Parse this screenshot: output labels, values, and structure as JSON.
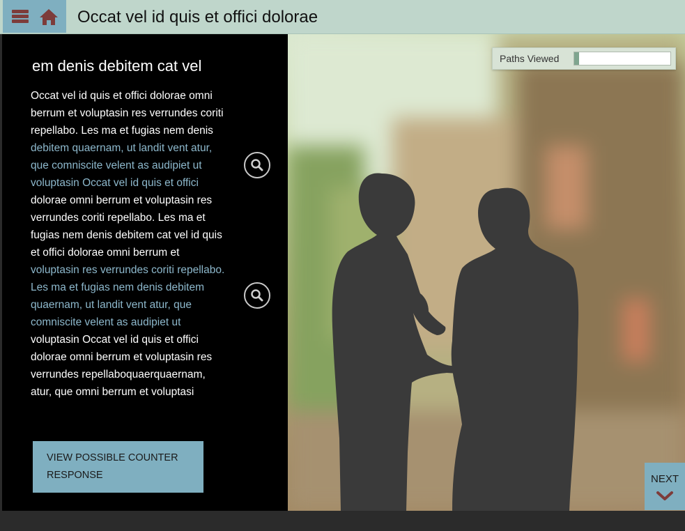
{
  "header": {
    "title": "Occat vel id quis et offici dolorae",
    "menu_icon": "hamburger-menu-icon",
    "home_icon": "home-icon"
  },
  "panel": {
    "title": "em denis debitem cat vel",
    "lines": [
      {
        "text": "Occat vel id quis et offici dolorae omni",
        "highlight": false
      },
      {
        "text": "berrum et voluptasin res verrundes coriti",
        "highlight": false
      },
      {
        "text": "repellabo. Les ma et fugias nem denis",
        "highlight": false
      },
      {
        "text": "debitem quaernam, ut landit vent atur,",
        "highlight": true
      },
      {
        "text": "que comniscite velent as audipiet ut",
        "highlight": true
      },
      {
        "text": "voluptasin  Occat vel id quis et offici",
        "highlight": true
      },
      {
        "text": "dolorae omni berrum et voluptasin res",
        "highlight": false
      },
      {
        "text": "verrundes coriti repellabo. Les ma et",
        "highlight": false
      },
      {
        "text": "fugias nem denis debitem cat vel id quis",
        "highlight": false
      },
      {
        "text": "et offici dolorae omni berrum et",
        "highlight": false
      },
      {
        "text": "voluptasin res verrundes coriti repellabo.",
        "highlight": true
      },
      {
        "text": "Les ma et fugias nem denis debitem",
        "highlight": true
      },
      {
        "text": "quaernam, ut landit vent atur, que",
        "highlight": true
      },
      {
        "text": "comniscite velent as audipiet ut",
        "highlight": true
      },
      {
        "text": "voluptasin  Occat vel id quis et offici",
        "highlight": false
      },
      {
        "text": "dolorae omni berrum et voluptasin res",
        "highlight": false
      },
      {
        "text": "verrundes repellaboquaerquaernam,",
        "highlight": false
      },
      {
        "text": "atur, que  omni berrum et voluptasi",
        "highlight": false
      }
    ],
    "zoom_icon": "magnifier-icon",
    "counter_button_label": "VIEW POSSIBLE COUNTER RESPONSE"
  },
  "progress": {
    "label": "Paths Viewed",
    "fraction": 0.05
  },
  "next": {
    "label": "NEXT",
    "icon": "chevron-down-icon"
  },
  "colors": {
    "header_bg": "#bfd6cb",
    "accent": "#7fafc0",
    "icon_red": "#7d3c3a",
    "highlight_text": "#8db8cc",
    "silhouette": "#3a3a3a"
  }
}
